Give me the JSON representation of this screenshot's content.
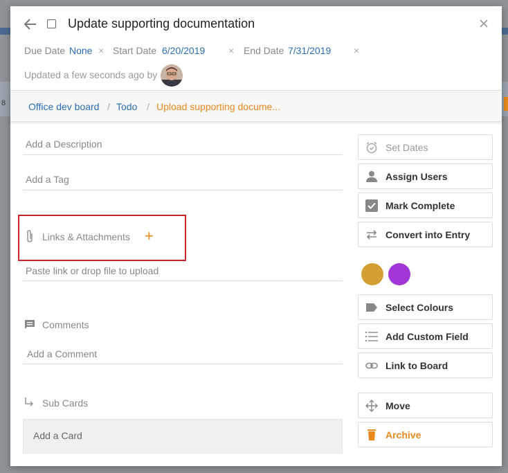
{
  "background": {
    "row_number": "8"
  },
  "card": {
    "title": "Update supporting documentation",
    "due_label": "Due Date",
    "due_value": "None",
    "start_label": "Start Date",
    "start_value": "6/20/2019",
    "end_label": "End Date",
    "end_value": "7/31/2019",
    "updated_text": "Updated a few seconds ago by",
    "clear_symbol": "×"
  },
  "breadcrumb": {
    "board": "Office dev board",
    "list": "Todo",
    "card": "Upload supporting docume...",
    "separator": "/"
  },
  "main": {
    "description_placeholder": "Add a Description",
    "tag_placeholder": "Add a Tag",
    "links_label": "Links & Attachments",
    "links_add": "+",
    "paste_placeholder": "Paste link or drop file to upload",
    "comments_label": "Comments",
    "comment_placeholder": "Add a Comment",
    "subcards_label": "Sub Cards",
    "add_card": "Add a Card"
  },
  "actions": {
    "set_dates": "Set Dates",
    "assign_users": "Assign Users",
    "mark_complete": "Mark Complete",
    "convert_entry": "Convert into Entry",
    "select_colours": "Select Colours",
    "add_custom_field": "Add Custom Field",
    "link_to_board": "Link to Board",
    "move": "Move",
    "archive": "Archive"
  },
  "colors": {
    "accent": "#e8891a",
    "link": "#2a6fb5",
    "swatch_1": "#d4a033",
    "swatch_2": "#a236d6",
    "highlight": "#c8222a"
  },
  "icons": {
    "back": "arrow-left-icon",
    "close": "close-icon",
    "paperclip": "paperclip-icon",
    "comment": "comment-icon",
    "subcard": "subdirectory-arrow-icon",
    "alarm": "alarm-clock-icon",
    "person": "person-icon",
    "check": "checkbox-checked-icon",
    "swap": "swap-arrows-icon",
    "label": "label-tag-icon",
    "list": "list-icon",
    "link": "link-icon",
    "move": "move-arrows-icon",
    "trash": "trash-icon"
  }
}
